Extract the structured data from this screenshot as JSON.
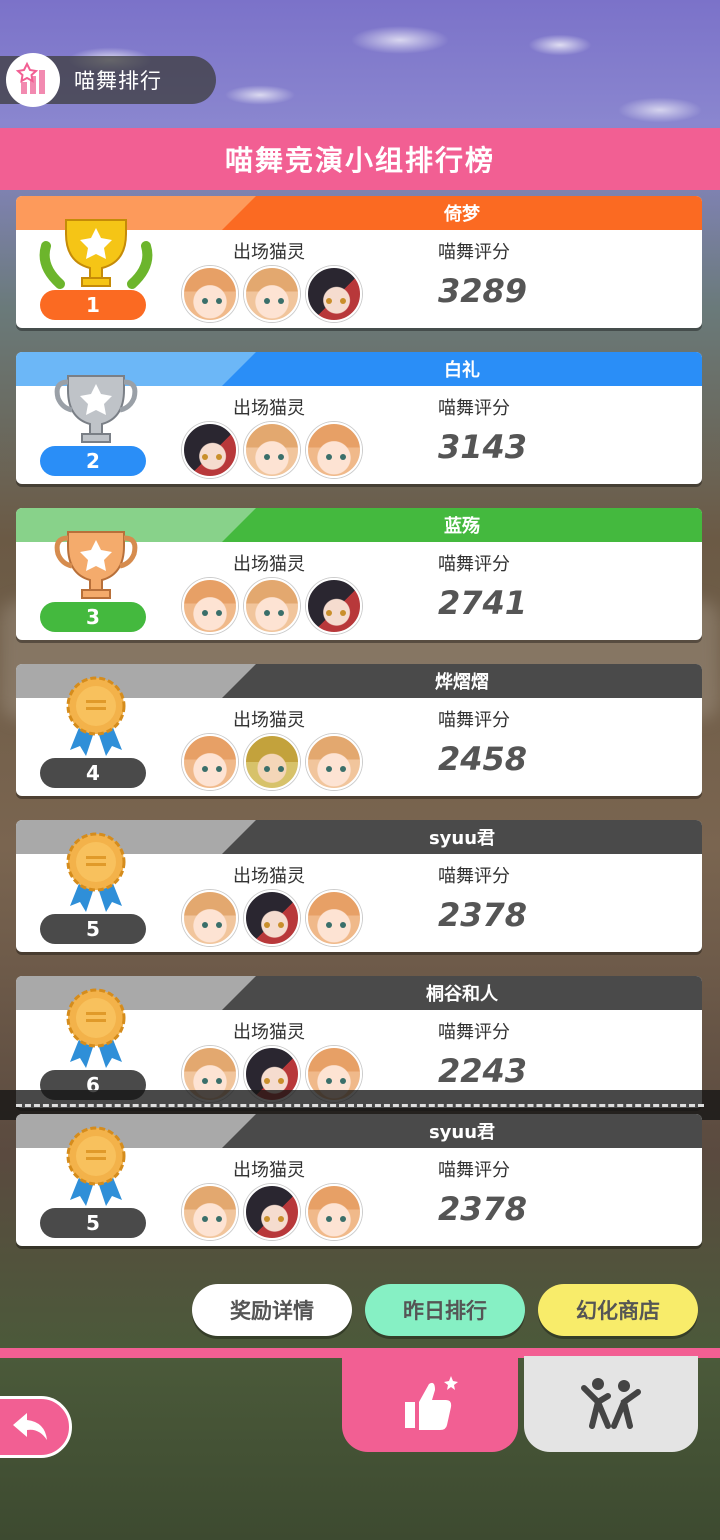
{
  "header": {
    "title": "喵舞排行",
    "board_title": "喵舞竞演小组排行榜"
  },
  "labels": {
    "cats": "出场猫灵",
    "score": "喵舞评分"
  },
  "colors": {
    "pink": "#f25f93",
    "gold_bar": "#fb6a22",
    "silver_bar": "#2a8ef7",
    "bronze_bar": "#44b93e",
    "other_bar": "#4a4a4a"
  },
  "entries": [
    {
      "rank": "1",
      "name": "倚梦",
      "score": "3289",
      "icon": "gold-trophy-icon",
      "avatars": [
        "a",
        "b",
        "d"
      ]
    },
    {
      "rank": "2",
      "name": "白礼",
      "score": "3143",
      "icon": "silver-trophy-icon",
      "avatars": [
        "d",
        "b",
        "a"
      ]
    },
    {
      "rank": "3",
      "name": "蓝殇",
      "score": "2741",
      "icon": "bronze-trophy-icon",
      "avatars": [
        "a",
        "b",
        "d"
      ]
    },
    {
      "rank": "4",
      "name": "烨熠熠",
      "score": "2458",
      "icon": "medal-icon",
      "avatars": [
        "a",
        "e",
        "b"
      ]
    },
    {
      "rank": "5",
      "name": "syuu君",
      "score": "2378",
      "icon": "medal-icon",
      "avatars": [
        "b",
        "d",
        "a"
      ]
    },
    {
      "rank": "6",
      "name": "桐谷和人",
      "score": "2243",
      "icon": "medal-icon",
      "avatars": [
        "b",
        "d",
        "a"
      ]
    }
  ],
  "my_entry": {
    "rank": "5",
    "name": "syuu君",
    "score": "2378",
    "icon": "medal-icon"
  },
  "buttons": {
    "reward": "奖励详情",
    "yesterday": "昨日排行",
    "shop": "幻化商店"
  }
}
